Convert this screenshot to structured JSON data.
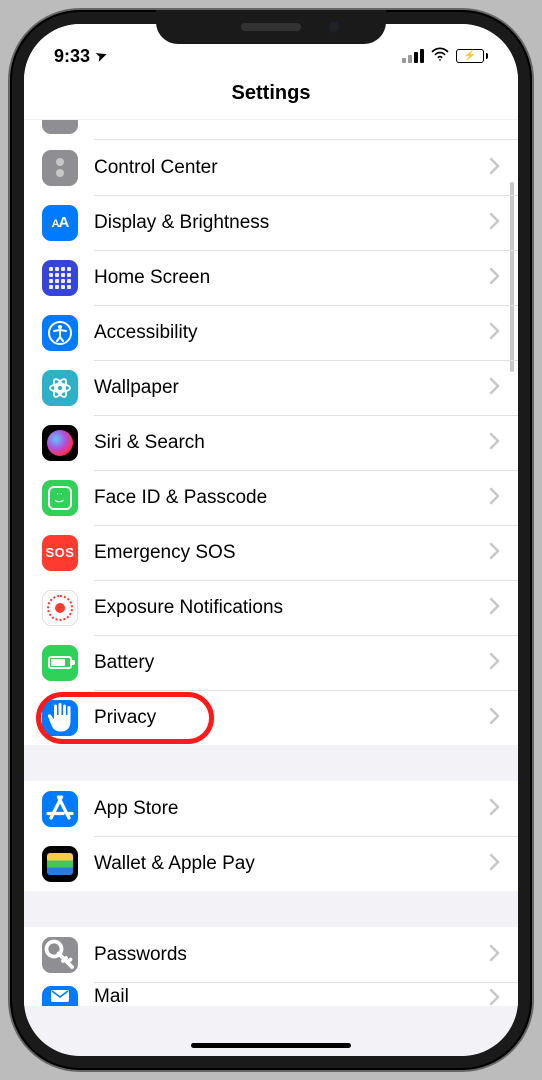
{
  "status": {
    "time": "9:33",
    "location_glyph": "➤"
  },
  "title": "Settings",
  "highlighted_item_name": "privacy",
  "groups": [
    {
      "partial_before": true,
      "items": [
        {
          "name": "control-center",
          "label": "Control Center",
          "icon": "cc",
          "color": "grey"
        },
        {
          "name": "display-brightness",
          "label": "Display & Brightness",
          "icon": "aa",
          "color": "blue"
        },
        {
          "name": "home-screen",
          "label": "Home Screen",
          "icon": "grid",
          "color": "indigo"
        },
        {
          "name": "accessibility",
          "label": "Accessibility",
          "icon": "accessibility",
          "color": "blue"
        },
        {
          "name": "wallpaper",
          "label": "Wallpaper",
          "icon": "flower",
          "color": "teal"
        },
        {
          "name": "siri-search",
          "label": "Siri & Search",
          "icon": "siri",
          "color": "black"
        },
        {
          "name": "faceid-passcode",
          "label": "Face ID & Passcode",
          "icon": "faceid",
          "color": "green"
        },
        {
          "name": "emergency-sos",
          "label": "Emergency SOS",
          "icon": "sos",
          "color": "red"
        },
        {
          "name": "exposure-notifications",
          "label": "Exposure Notifications",
          "icon": "exposure",
          "color": "white"
        },
        {
          "name": "battery",
          "label": "Battery",
          "icon": "battery",
          "color": "green"
        },
        {
          "name": "privacy",
          "label": "Privacy",
          "icon": "hand",
          "color": "blue"
        }
      ]
    },
    {
      "items": [
        {
          "name": "app-store",
          "label": "App Store",
          "icon": "appstore",
          "color": "blue"
        },
        {
          "name": "wallet-apple-pay",
          "label": "Wallet & Apple Pay",
          "icon": "wallet",
          "color": "black"
        }
      ]
    },
    {
      "partial_after": true,
      "items": [
        {
          "name": "passwords",
          "label": "Passwords",
          "icon": "key",
          "color": "grey"
        },
        {
          "name": "mail",
          "label": "Mail",
          "icon": "mail",
          "color": "blue"
        }
      ]
    }
  ]
}
